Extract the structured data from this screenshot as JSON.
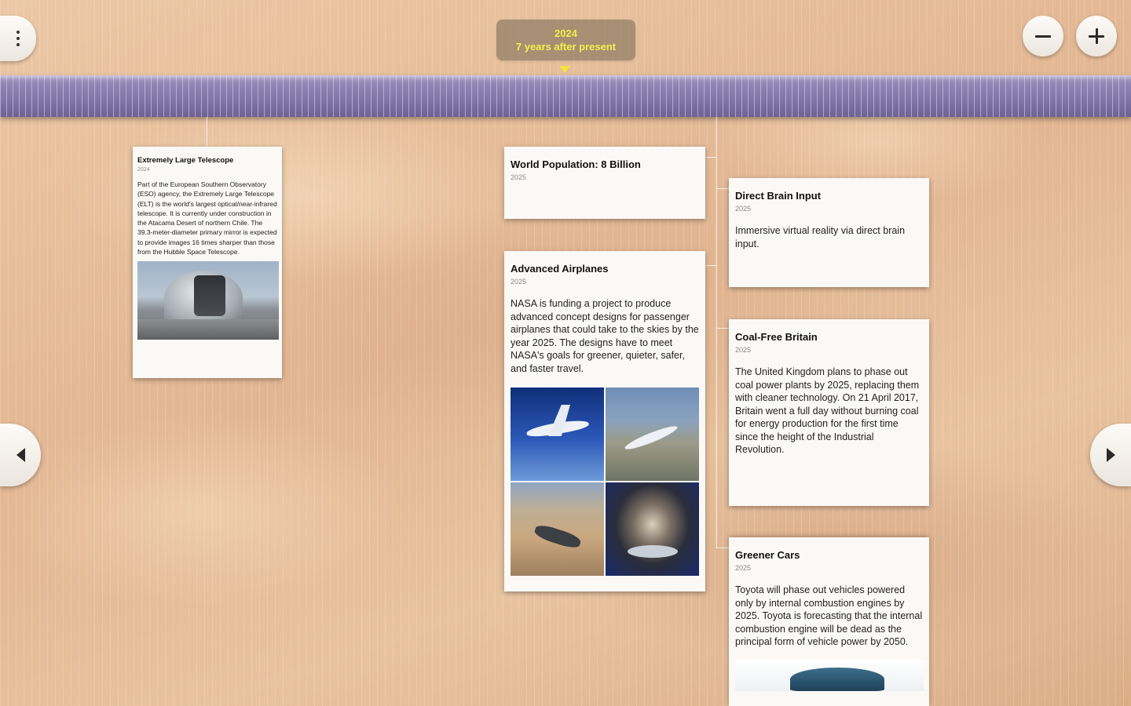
{
  "header": {
    "date_year": "2024",
    "date_relative": "7 years after present"
  },
  "toolbar": {
    "menu_icon": "more-vertical-icon",
    "zoom_out_icon": "minus-icon",
    "zoom_in_icon": "plus-icon"
  },
  "navigation": {
    "prev_icon": "arrow-left-icon",
    "next_icon": "arrow-right-icon"
  },
  "colors": {
    "ruler": "#8c80ae",
    "date_text": "#f4ef4a",
    "background": "#e6bf9c"
  },
  "events": {
    "telescope": {
      "title": "Extremely Large Telescope",
      "year": "2024",
      "description": "Part of the European Southern Observatory (ESO) agency, the Extremely Large Telescope (ELT) is the world's largest optical/near-infrared telescope. It is currently under construction in the Atacama Desert of northern Chile. The 39.3-meter-diameter primary mirror is expected to provide images 16 times sharper than those from the Hubble Space Telescope."
    },
    "population": {
      "title": "World Population: 8 Billion",
      "year": "2025"
    },
    "airplanes": {
      "title": "Advanced Airplanes",
      "year": "2025",
      "description": "NASA is funding a project to produce advanced concept designs for passenger airplanes that could take to the skies by the year 2025. The designs have to meet NASA's goals for greener, quieter, safer, and faster travel."
    },
    "brain": {
      "title": "Direct Brain Input",
      "year": "2025",
      "description": "Immersive virtual reality via direct brain input."
    },
    "coal": {
      "title": "Coal-Free Britain",
      "year": "2025",
      "description": "The United Kingdom plans to phase out coal power plants by 2025, replacing them with cleaner technology. On 21 April 2017, Britain went a full day without burning coal for energy production for the first time since the height of the Industrial Revolution."
    },
    "cars": {
      "title": "Greener Cars",
      "year": "2025",
      "description": "Toyota will phase out vehicles powered only by internal combustion engines by 2025. Toyota is forecasting that the internal combustion engine will be dead as the principal form of vehicle power by 2050."
    }
  }
}
